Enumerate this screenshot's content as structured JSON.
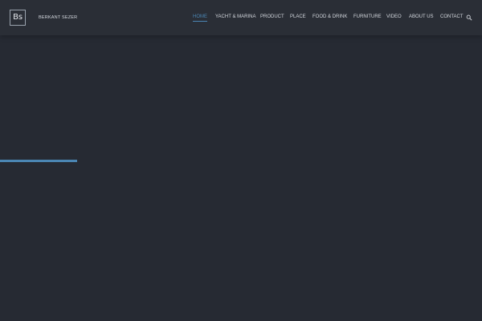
{
  "brand": {
    "logo_text": "Bs",
    "name": "BERKANT SEZER"
  },
  "nav": {
    "items": [
      {
        "label": "HOME",
        "active": true
      },
      {
        "label": "YACHT & MARINA",
        "active": false
      },
      {
        "label": "PRODUCT",
        "active": false
      },
      {
        "label": "PLACE",
        "active": false
      },
      {
        "label": "FOOD & DRINK",
        "active": false
      },
      {
        "label": "FURNITURE",
        "active": false
      },
      {
        "label": "VIDEO",
        "active": false
      },
      {
        "label": "ABOUT US",
        "active": false
      },
      {
        "label": "CONTACT",
        "active": false
      }
    ],
    "search_icon": "search-icon"
  },
  "loader": {
    "progress_percent": 16
  },
  "colors": {
    "background": "#262a33",
    "header": "#2a2e36",
    "accent": "#4b86b4",
    "text": "#d4d8de"
  }
}
